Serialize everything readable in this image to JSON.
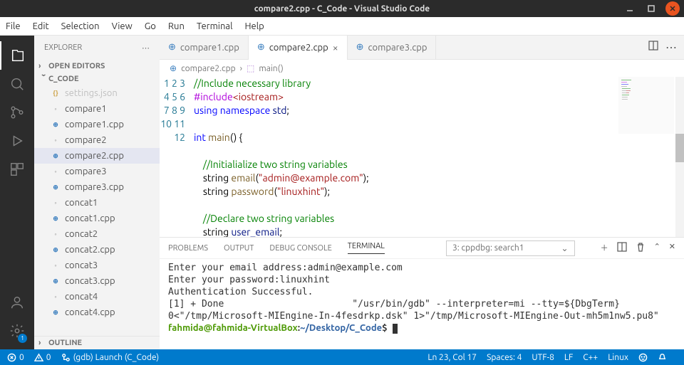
{
  "titlebar": {
    "title": "compare2.cpp - C_Code - Visual Studio Code"
  },
  "menu": {
    "items": [
      "File",
      "Edit",
      "Selection",
      "View",
      "Go",
      "Run",
      "Terminal",
      "Help"
    ]
  },
  "activity": {
    "badge": "1"
  },
  "sidebar": {
    "header": "EXPLORER",
    "open_editors": "OPEN EDITORS",
    "project": "C_CODE",
    "outline": "OUTLINE",
    "files": [
      {
        "name": "settings.json",
        "type": "json",
        "dim": true
      },
      {
        "name": "compare1",
        "type": "bin"
      },
      {
        "name": "compare1.cpp",
        "type": "cpp"
      },
      {
        "name": "compare2",
        "type": "bin"
      },
      {
        "name": "compare2.cpp",
        "type": "cpp",
        "active": true
      },
      {
        "name": "compare3",
        "type": "bin"
      },
      {
        "name": "compare3.cpp",
        "type": "cpp"
      },
      {
        "name": "concat1",
        "type": "bin"
      },
      {
        "name": "concat1.cpp",
        "type": "cpp"
      },
      {
        "name": "concat2",
        "type": "bin"
      },
      {
        "name": "concat2.cpp",
        "type": "cpp"
      },
      {
        "name": "concat3",
        "type": "bin"
      },
      {
        "name": "concat3.cpp",
        "type": "cpp"
      },
      {
        "name": "concat4",
        "type": "bin"
      },
      {
        "name": "concat4.cpp",
        "type": "cpp"
      }
    ]
  },
  "tabs": [
    {
      "label": "compare1.cpp"
    },
    {
      "label": "compare2.cpp",
      "active": true
    },
    {
      "label": "compare3.cpp"
    }
  ],
  "breadcrumb": {
    "file": "compare2.cpp",
    "symbol": "main()"
  },
  "editor": {
    "lines": [
      1,
      2,
      3,
      4,
      5,
      6,
      7,
      8,
      9,
      10,
      11,
      12
    ]
  },
  "panel": {
    "tabs": {
      "problems": "PROBLEMS",
      "output": "OUTPUT",
      "debug": "DEBUG CONSOLE",
      "terminal": "TERMINAL"
    },
    "selector": "3: cppdbg: search1",
    "terminal_lines": [
      "Enter your email address:admin@example.com",
      "Enter your password:linuxhint",
      "Authentication Successful.",
      "[1] + Done                       \"/usr/bin/gdb\" --interpreter=mi --tty=${DbgTerm} 0<\"/tmp/Microsoft-MIEngine-In-4fesdrkp.dsk\" 1>\"/tmp/Microsoft-MIEngine-Out-mh5m1nw5.pu8\""
    ],
    "prompt": {
      "user": "fahmida@fahmida-VirtualBox",
      "path": "~/Desktop/C_Code"
    }
  },
  "status": {
    "errors": "0",
    "warnings": "0",
    "launch": "(gdb) Launch (C_Code)",
    "lncol": "Ln 23, Col 17",
    "spaces": "Spaces: 4",
    "encoding": "UTF-8",
    "eol": "LF",
    "lang": "C++",
    "os": "Linux"
  }
}
